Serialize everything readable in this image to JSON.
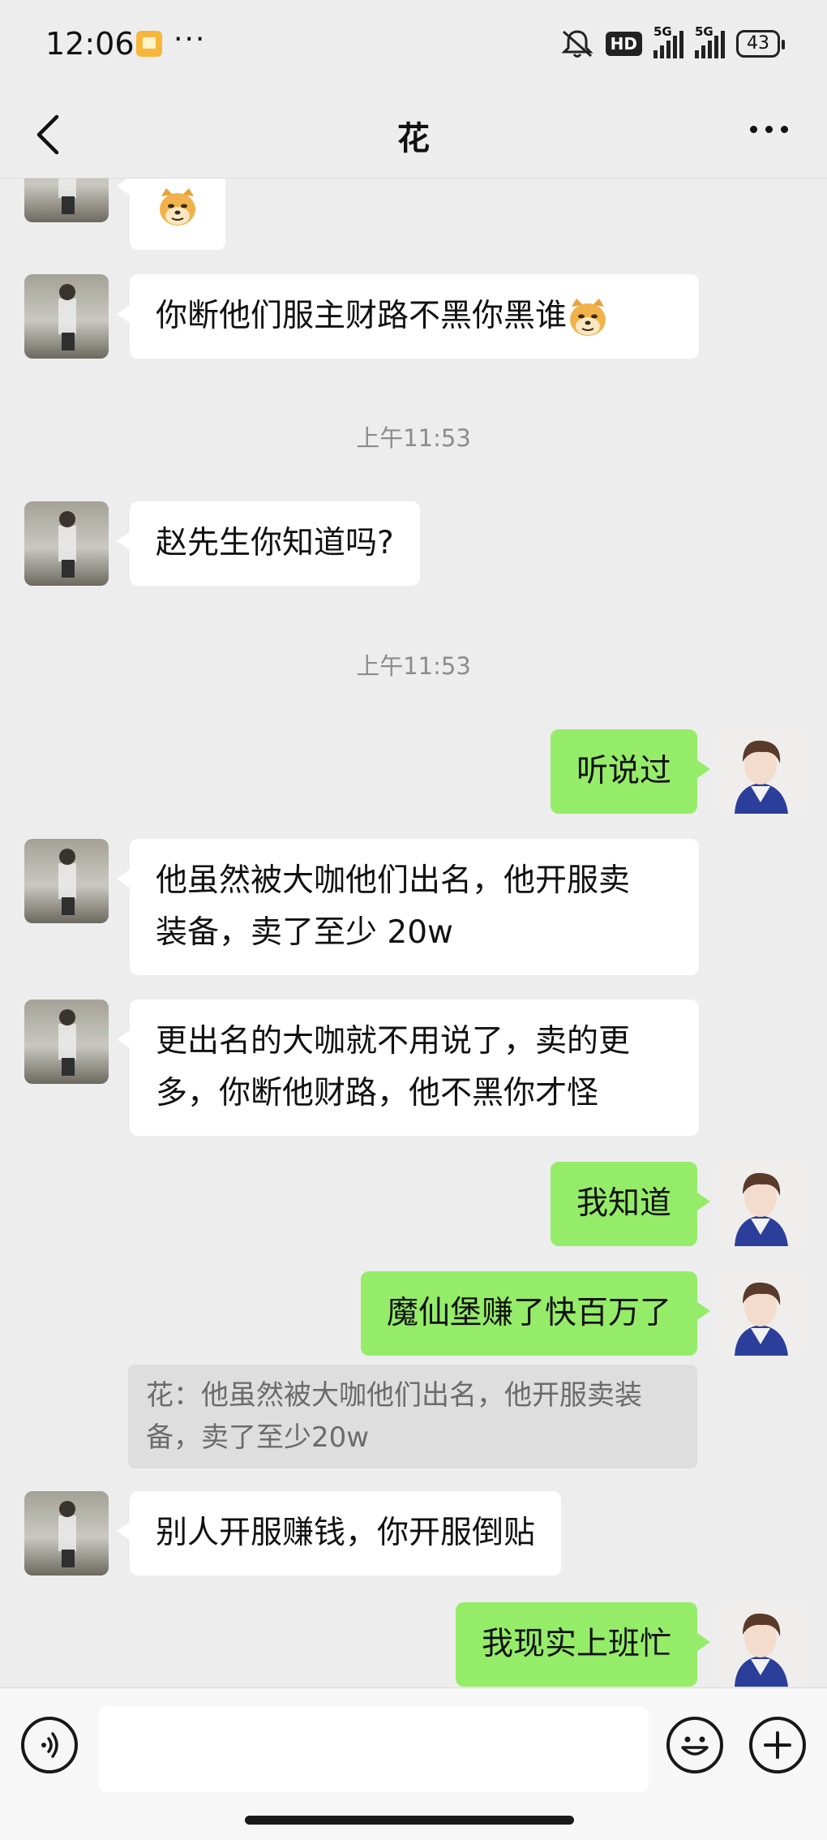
{
  "status_bar": {
    "time": "12:06",
    "more": "···",
    "hd": "HD",
    "net1": "5G",
    "net2": "5G",
    "battery": "43"
  },
  "nav": {
    "title": "花"
  },
  "timestamps": [
    "上午11:53",
    "上午11:53"
  ],
  "messages": [
    {
      "from": "花",
      "lines": [
        "你断他们服主财路不黑你黑谁"
      ],
      "emoji_after": "doge-emoji"
    },
    {
      "from": "花",
      "lines": [
        "赵先生你知道吗?"
      ]
    },
    {
      "from": "me",
      "lines": [
        "听说过"
      ]
    },
    {
      "from": "花",
      "lines": [
        "他虽然被大咖他们出名，他开服卖",
        "装备，卖了至少 20w"
      ]
    },
    {
      "from": "花",
      "lines": [
        "更出名的大咖就不用说了，卖的更",
        "多，你断他财路，他不黑你才怪"
      ]
    },
    {
      "from": "me",
      "lines": [
        "我知道"
      ]
    },
    {
      "from": "me",
      "lines": [
        "魔仙堡赚了快百万了"
      ]
    },
    {
      "from": "花",
      "lines": [
        "别人开服赚钱，你开服倒贴"
      ]
    },
    {
      "from": "me",
      "lines": [
        "我现实上班忙"
      ]
    }
  ],
  "quote": {
    "lines": [
      "花：他虽然被大咖他们出名，他开服卖装",
      "备，卖了至少20w"
    ]
  },
  "input": {
    "placeholder": ""
  },
  "colors": {
    "background": "#ededed",
    "outgoing_bubble": "#95ec69",
    "incoming_bubble": "#ffffff"
  }
}
